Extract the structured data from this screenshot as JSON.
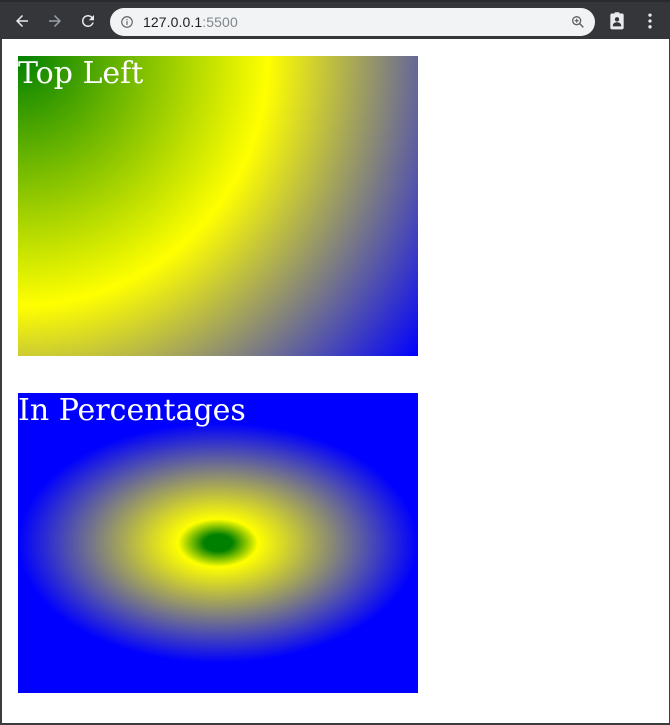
{
  "browser": {
    "url_host": "127.0.0.1",
    "url_port": ":5500",
    "icons": {
      "back": "arrow-left-icon",
      "forward": "arrow-right-icon",
      "reload": "reload-icon",
      "site_info": "info-icon",
      "zoom": "zoom-icon",
      "extension": "clipboard-badge-icon",
      "menu": "kebab-menu-icon"
    }
  },
  "page": {
    "boxes": [
      {
        "label": "Top Left",
        "gradient": "radial circle at top left: green, yellow, blue"
      },
      {
        "label": "In Percentages",
        "gradient": "radial ellipse at center: green, yellow, blue"
      }
    ]
  },
  "colors": {
    "toolbar": "#35363a",
    "omnibox": "#f1f3f4",
    "page_background": "#ffffff",
    "gradient_green": "#008000",
    "gradient_yellow": "#ffff00",
    "gradient_blue": "#0000ff",
    "label_text": "#ffffff"
  }
}
